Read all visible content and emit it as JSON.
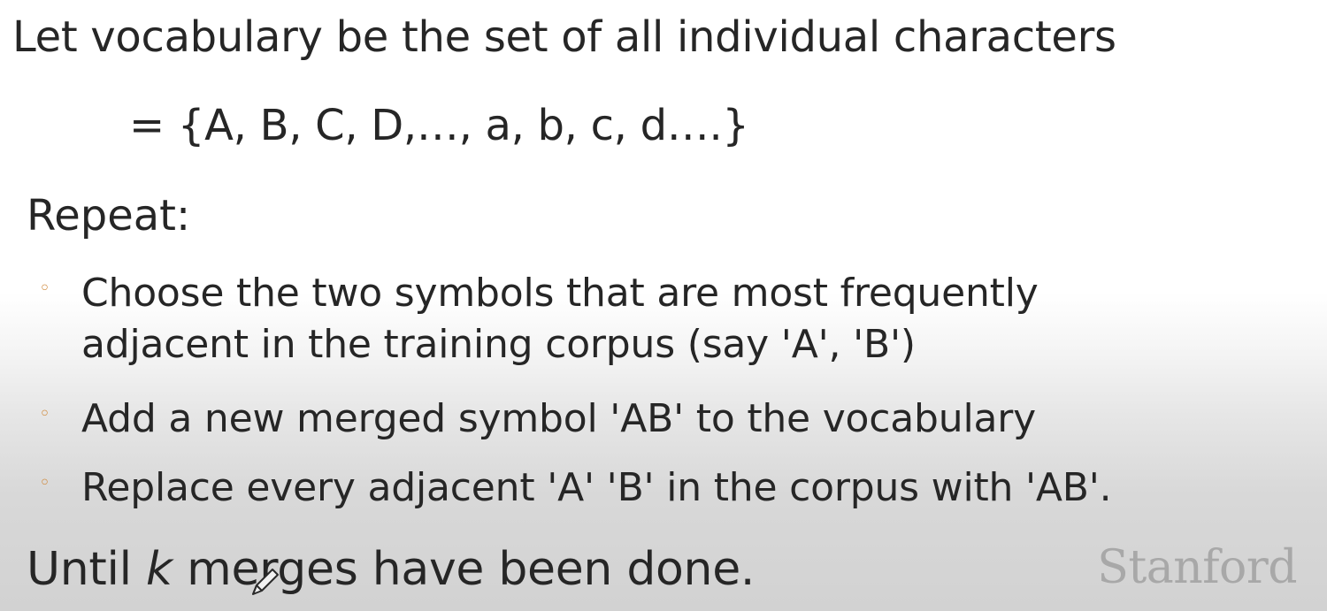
{
  "slide": {
    "intro": "Let vocabulary be the set of all individual characters",
    "vocab_set": "= {A, B, C, D,…, a, b, c, d….}",
    "repeat_heading": "Repeat:",
    "bullets": [
      {
        "line1": "Choose the two symbols that are most frequently",
        "line2": "adjacent in the training corpus (say 'A', 'B')"
      },
      {
        "line1": "Add a new merged symbol 'AB' to the vocabulary"
      },
      {
        "line1": "Replace every adjacent 'A' 'B' in the corpus with 'AB'."
      }
    ],
    "until": {
      "prefix": "Until ",
      "variable": "k",
      "suffix": " merges have been done."
    },
    "bullet_marker": "◦",
    "logo": "Stanford"
  },
  "colors": {
    "text": "#262626",
    "bullet_marker": "#d08a3d",
    "logo": "#a8a8a8"
  },
  "icons": {
    "cursor": "pen-cursor-icon"
  }
}
